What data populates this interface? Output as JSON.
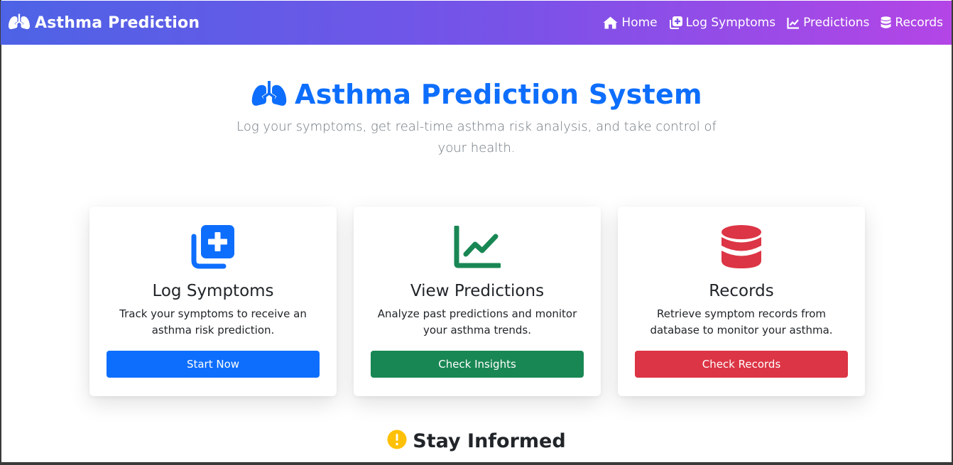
{
  "navbar": {
    "brand": "Asthma Prediction",
    "brand_icon": "lungs-icon",
    "links": [
      {
        "label": "Home",
        "icon": "house-icon"
      },
      {
        "label": "Log Symptoms",
        "icon": "plus-square-icon"
      },
      {
        "label": "Predictions",
        "icon": "chart-line-icon"
      },
      {
        "label": "Records",
        "icon": "database-icon"
      }
    ]
  },
  "hero": {
    "title": "Asthma Prediction System",
    "subtitle": "Log your symptoms, get real-time asthma risk analysis, and take control of your health."
  },
  "cards": [
    {
      "title": "Log Symptoms",
      "text": "Track your symptoms to receive an asthma risk prediction.",
      "button": "Start Now",
      "icon": "plus-square-icon",
      "color": "#0d6efd"
    },
    {
      "title": "View Predictions",
      "text": "Analyze past predictions and monitor your asthma trends.",
      "button": "Check Insights",
      "icon": "chart-line-icon",
      "color": "#198754"
    },
    {
      "title": "Records",
      "text": "Retrieve symptom records from database to monitor your asthma.",
      "button": "Check Records",
      "icon": "database-icon",
      "color": "#dc3545"
    }
  ],
  "info_section": {
    "title": "Stay Informed",
    "icon": "exclamation-circle-icon"
  },
  "colors": {
    "primary": "#0d6efd",
    "success": "#198754",
    "danger": "#dc3545",
    "warning": "#ffc107",
    "nav_gradient_start": "#4d63e6",
    "nav_gradient_end": "#b445e6"
  }
}
